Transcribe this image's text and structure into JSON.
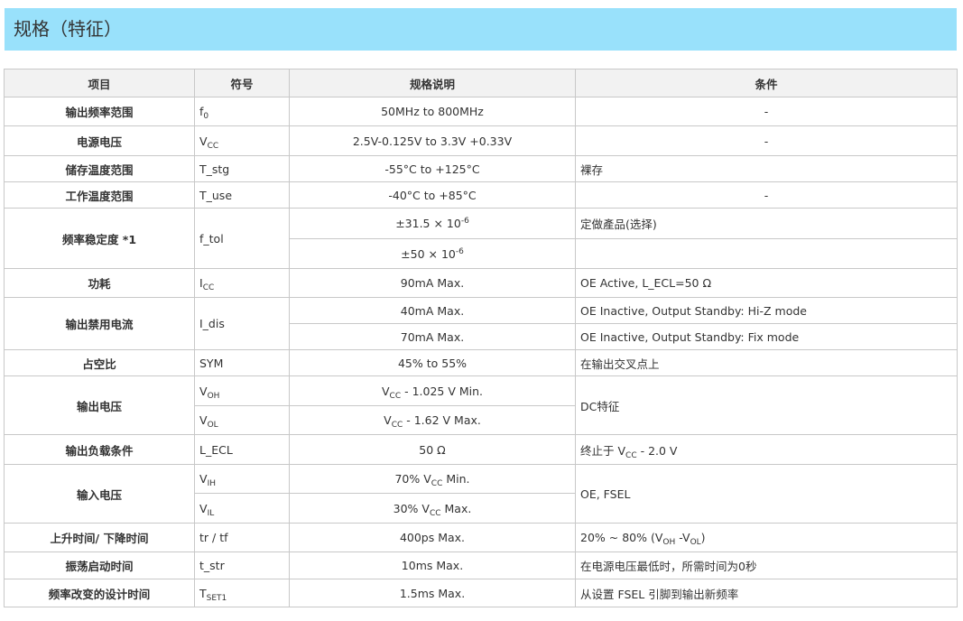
{
  "title": "规格（特征）",
  "headers": {
    "item": "项目",
    "symbol": "符号",
    "spec": "规格说明",
    "condition": "条件"
  },
  "rows": {
    "r1": {
      "item": "输出频率范围",
      "sym": "f",
      "sym_sub": "0",
      "spec": "50MHz to 800MHz",
      "cond": "-"
    },
    "r2": {
      "item": "电源电压",
      "sym": "V",
      "sym_sub": "CC",
      "spec": "2.5V-0.125V to 3.3V +0.33V",
      "cond": "-"
    },
    "r3": {
      "item": "储存温度范围",
      "sym": "T_stg",
      "spec": "-55°C to +125°C",
      "cond": "裸存"
    },
    "r4": {
      "item": "工作温度范围",
      "sym": "T_use",
      "spec": "-40°C to +85°C",
      "cond": "-"
    },
    "r5": {
      "item": "频率稳定度 *1",
      "sym": "f_tol",
      "spec_a": "±31.5 × 10",
      "spec_a_sup": "-6",
      "cond_a": "定做產品(选择)",
      "spec_b": "±50 × 10",
      "spec_b_sup": "-6",
      "cond_b": ""
    },
    "r6": {
      "item": "功耗",
      "sym": "I",
      "sym_sub": "CC",
      "spec": "90mA Max.",
      "cond": "OE Active, L_ECL=50 Ω"
    },
    "r7": {
      "item": "输出禁用电流",
      "sym": "I_dis",
      "spec_a": "40mA Max.",
      "cond_a": "OE Inactive, Output Standby: Hi-Z mode",
      "spec_b": "70mA Max.",
      "cond_b": "OE Inactive, Output Standby: Fix mode"
    },
    "r8": {
      "item": "占空比",
      "sym": "SYM",
      "spec": "45% to 55%",
      "cond": "在输出交叉点上"
    },
    "r9": {
      "item": "输出电压",
      "sym_a": "V",
      "sym_a_sub": "OH",
      "spec_a_pre": "V",
      "spec_a_sub": "CC",
      "spec_a_post": " - 1.025 V Min.",
      "sym_b": "V",
      "sym_b_sub": "OL",
      "spec_b_pre": "V",
      "spec_b_sub": "CC",
      "spec_b_post": " - 1.62 V Max.",
      "cond": "DC特征"
    },
    "r10": {
      "item": "输出负载条件",
      "sym": "L_ECL",
      "spec": "50 Ω",
      "cond_pre": "终止于 V",
      "cond_sub": "CC",
      "cond_post": " - 2.0 V"
    },
    "r11": {
      "item": "输入电压",
      "sym_a": "V",
      "sym_a_sub": "IH",
      "spec_a_pre": "70% V",
      "spec_a_sub": "CC",
      "spec_a_post": " Min.",
      "sym_b": "V",
      "sym_b_sub": "IL",
      "spec_b_pre": "30% V",
      "spec_b_sub": "CC",
      "spec_b_post": " Max.",
      "cond": "OE, FSEL"
    },
    "r12": {
      "item": "上升时间/ 下降时间",
      "sym": "tr / tf",
      "spec": "400ps Max.",
      "cond_pre": "20% ~ 80% (V",
      "cond_sub1": "OH",
      "cond_mid": " -V",
      "cond_sub2": "OL",
      "cond_post": ")"
    },
    "r13": {
      "item": "振荡启动时间",
      "sym": "t_str",
      "spec": "10ms Max.",
      "cond": "在电源电压最低时，所需时间为0秒"
    },
    "r14": {
      "item": "频率改变的设计时间",
      "sym": "T",
      "sym_sub": "SET1",
      "spec": "1.5ms Max.",
      "cond": "从设置 FSEL 引脚到输出新频率"
    }
  }
}
